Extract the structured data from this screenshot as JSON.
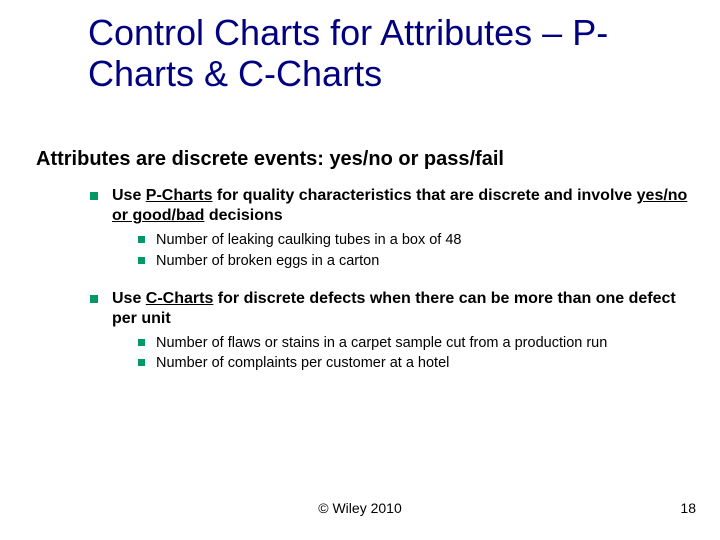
{
  "title": "Control Charts for Attributes – P-Charts & C-Charts",
  "intro": "Attributes are discrete events: yes/no or pass/fail",
  "sections": [
    {
      "lead_pre": "Use ",
      "lead_u": "P-Charts",
      "lead_mid": " for quality characteristics that are discrete and involve ",
      "lead_u2": "yes/no or good/bad",
      "lead_post": " decisions",
      "subs": [
        "Number of leaking caulking tubes in a box of 48",
        "Number of broken eggs in a carton"
      ]
    },
    {
      "lead_pre": "Use ",
      "lead_u": "C-Charts",
      "lead_mid": " for discrete defects when there can be more than one defect per unit",
      "lead_u2": "",
      "lead_post": "",
      "subs": [
        "Number of flaws or stains in a carpet sample cut from a production run",
        "Number of complaints per customer at a hotel"
      ]
    }
  ],
  "footer": {
    "center": "© Wiley 2010",
    "right": "18"
  }
}
